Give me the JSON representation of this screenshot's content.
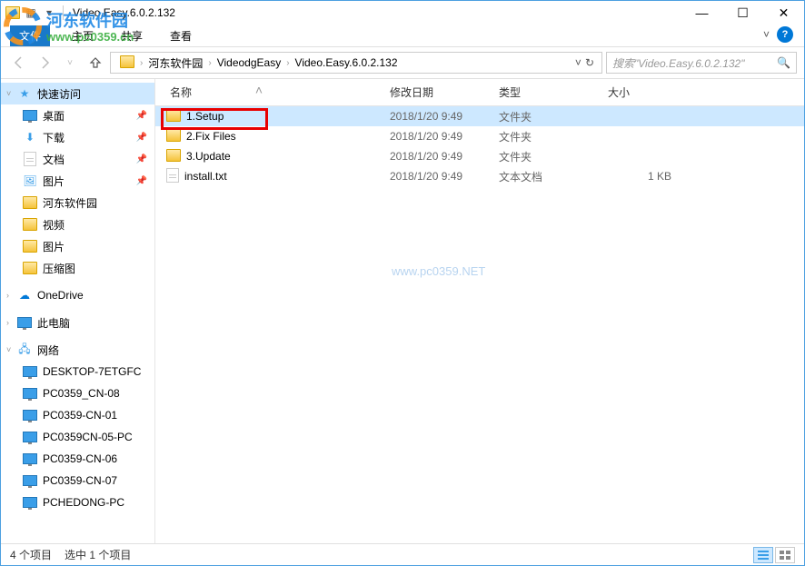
{
  "window": {
    "title": "Video.Easy.6.0.2.132"
  },
  "ribbon": {
    "file": "文件",
    "home": "主页",
    "share": "共享",
    "view": "查看"
  },
  "breadcrumb": {
    "items": [
      "河东软件园",
      "VideodgEasy",
      "Video.Easy.6.0.2.132"
    ]
  },
  "search": {
    "placeholder": "搜索\"Video.Easy.6.0.2.132\""
  },
  "columns": {
    "name": "名称",
    "date": "修改日期",
    "type": "类型",
    "size": "大小"
  },
  "files": [
    {
      "name": "1.Setup",
      "date": "2018/1/20 9:49",
      "type": "文件夹",
      "size": "",
      "icon": "folder",
      "selected": true
    },
    {
      "name": "2.Fix Files",
      "date": "2018/1/20 9:49",
      "type": "文件夹",
      "size": "",
      "icon": "folder",
      "selected": false
    },
    {
      "name": "3.Update",
      "date": "2018/1/20 9:49",
      "type": "文件夹",
      "size": "",
      "icon": "folder",
      "selected": false
    },
    {
      "name": "install.txt",
      "date": "2018/1/20 9:49",
      "type": "文本文档",
      "size": "1 KB",
      "icon": "file",
      "selected": false
    }
  ],
  "sidebar": {
    "quickaccess": "快速访问",
    "desktop": "桌面",
    "downloads": "下载",
    "documents": "文档",
    "pictures": "图片",
    "hedong": "河东软件园",
    "video": "视频",
    "pictures2": "图片",
    "compressed": "压缩图",
    "onedrive": "OneDrive",
    "thispc": "此电脑",
    "network": "网络",
    "computers": [
      "DESKTOP-7ETGFC",
      "PC0359_CN-08",
      "PC0359-CN-01",
      "PC0359CN-05-PC",
      "PC0359-CN-06",
      "PC0359-CN-07",
      "PCHEDONG-PC"
    ]
  },
  "statusbar": {
    "count": "4 个项目",
    "selected": "选中 1 个项目"
  },
  "watermark": {
    "logo_text1": "河东软件园",
    "logo_text2": "www.pc0359.cn",
    "center": "www.pc0359.NET"
  }
}
